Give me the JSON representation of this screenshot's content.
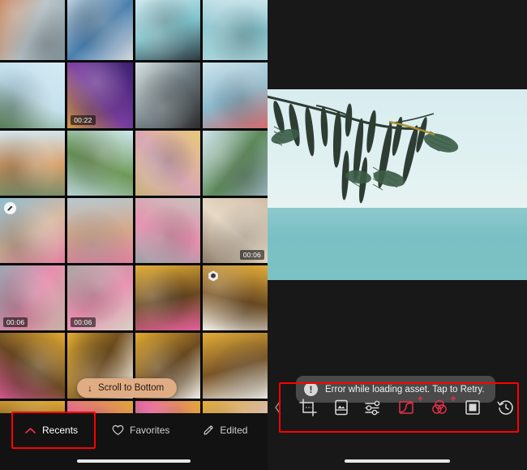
{
  "app": {
    "accent_red": "#e8304a",
    "annotation_color": "#ff0000",
    "panel_bg": "#121212"
  },
  "left_panel": {
    "scroll_pill": {
      "label": "Scroll to Bottom",
      "arrow_icon": "arrow-down-icon",
      "bg_color": "#e0ac84"
    },
    "tabs": [
      {
        "label": "Recents",
        "icon": "chevron-up-icon",
        "active": true,
        "annotated": true
      },
      {
        "label": "Favorites",
        "icon": "heart-icon",
        "active": false,
        "annotated": false
      },
      {
        "label": "Edited",
        "icon": "pencil-icon",
        "active": false,
        "annotated": false
      }
    ],
    "grid": {
      "columns": 4,
      "badges": {
        "video_durations": [
          "00:22",
          "00:06",
          "00:06",
          "00:06"
        ],
        "edit_badge_icon": "pencil-badge-icon",
        "burst_badge_icon": "burst-stack-icon"
      },
      "items": [
        {
          "id": 1,
          "kind": "photo",
          "desc": "woman in orange coat by waterfront",
          "c1": "#c4794a",
          "c2": "#b9c6cb",
          "c3": "#8fa3ab"
        },
        {
          "id": 2,
          "kind": "photo",
          "desc": "city skyline with cruise ship",
          "c1": "#cfe2ee",
          "c2": "#4a7fae",
          "c3": "#d6d9dc"
        },
        {
          "id": 3,
          "kind": "photo",
          "desc": "hanging clothes over sea",
          "c1": "#d9edf2",
          "c2": "#7fc3cc",
          "c3": "#2e3a40"
        },
        {
          "id": 4,
          "kind": "photo",
          "desc": "sea horizon pale blue",
          "c1": "#d5e9ef",
          "c2": "#86c3cd",
          "c3": "#a9d4da"
        },
        {
          "id": 5,
          "kind": "photo",
          "desc": "bright sky with tree and tower",
          "c1": "#d7ecf5",
          "c2": "#bcdcea",
          "c3": "#5f8a5c"
        },
        {
          "id": 6,
          "kind": "video",
          "duration": "00:22",
          "desc": "people with birthday cake at night",
          "c1": "#3a1f6e",
          "c2": "#7b3fa0",
          "c3": "#e0a44a"
        },
        {
          "id": 7,
          "kind": "photo",
          "desc": "man from behind on promenade",
          "c1": "#d9e4e4",
          "c2": "#6d7a80",
          "c3": "#2b2b2b"
        },
        {
          "id": 8,
          "kind": "photo",
          "desc": "bridge and river city view",
          "c1": "#cfe5ee",
          "c2": "#8bb8cc",
          "c3": "#d86a6a"
        },
        {
          "id": 9,
          "kind": "photo",
          "desc": "woman in hat at railing",
          "c1": "#d2e6ef",
          "c2": "#d8a06a",
          "c3": "#7a8f6a"
        },
        {
          "id": 10,
          "kind": "photo",
          "desc": "rooftop greenery and river",
          "c1": "#cfe8f0",
          "c2": "#6d9a57",
          "c3": "#b6cfd6"
        },
        {
          "id": 11,
          "kind": "photo",
          "desc": "ID cards on pink board",
          "c1": "#e8c97a",
          "c2": "#d9a7b4",
          "c3": "#c9b177"
        },
        {
          "id": 12,
          "kind": "photo",
          "desc": "riverside boats with trees",
          "c1": "#cfe4f0",
          "c2": "#5d8a5a",
          "c3": "#9fb8c3"
        },
        {
          "id": 13,
          "kind": "photo",
          "edited": true,
          "desc": "pool and cup hand",
          "c1": "#8fbcd0",
          "c2": "#d9b9a0",
          "c3": "#e07fa0"
        },
        {
          "id": 14,
          "kind": "photo",
          "desc": "harbor with drink in hand",
          "c1": "#b7c9cf",
          "c2": "#d5a98c",
          "c3": "#e07fa0"
        },
        {
          "id": 15,
          "kind": "photo",
          "desc": "hands holding pink cups",
          "c1": "#c8c4bd",
          "c2": "#e88fae",
          "c3": "#9aa0a6"
        },
        {
          "id": 16,
          "kind": "video",
          "duration": "00:06",
          "desc": "cups on table overhead",
          "c1": "#c9b39a",
          "c2": "#e7d9c6",
          "c3": "#8a7a68"
        },
        {
          "id": 17,
          "kind": "video",
          "duration": "00:06",
          "desc": "pink cup street scene",
          "c1": "#9aa5b0",
          "c2": "#e88fae",
          "c3": "#c2b2a4"
        },
        {
          "id": 18,
          "kind": "video",
          "duration": "00:06",
          "desc": "pink cups on pavement",
          "c1": "#a9a6a2",
          "c2": "#e88fae",
          "c3": "#d9d2c8"
        },
        {
          "id": 19,
          "kind": "photo",
          "desc": "yellow colonial building",
          "c1": "#e3ad33",
          "c2": "#6b4a22",
          "c3": "#e45f9b"
        },
        {
          "id": 20,
          "kind": "photo",
          "burst": true,
          "desc": "woman in white dress by yellow wall",
          "c1": "#e0aa36",
          "c2": "#7a5526",
          "c3": "#f2f0ea"
        },
        {
          "id": 21,
          "kind": "photo",
          "desc": "yellow wall with woman walking",
          "c1": "#dfa932",
          "c2": "#6b4a22",
          "c3": "#e45f9b"
        },
        {
          "id": 22,
          "kind": "photo",
          "desc": "woman in hat yellow facade",
          "c1": "#e1ab34",
          "c2": "#74501f",
          "c3": "#f4f2ec"
        },
        {
          "id": 23,
          "kind": "photo",
          "desc": "woman with bag yellow facade",
          "c1": "#dfa930",
          "c2": "#6e4c20",
          "c3": "#efeee8"
        },
        {
          "id": 24,
          "kind": "photo",
          "desc": "woman at yellow doorway",
          "c1": "#e2ac38",
          "c2": "#7a5526",
          "c3": "#f2f0ea"
        },
        {
          "id": 25,
          "kind": "photo",
          "desc": "yellow wall flowers lower",
          "c1": "#e0aa34",
          "c2": "#6b4a22",
          "c3": "#e45f9b"
        },
        {
          "id": 26,
          "kind": "photo",
          "desc": "flower boxes yellow wall",
          "c1": "#dfa932",
          "c2": "#e45f9b",
          "c3": "#7a5526"
        },
        {
          "id": 27,
          "kind": "photo",
          "desc": "pink flowers yellow wall",
          "c1": "#e1ab34",
          "c2": "#e45f9b",
          "c3": "#74501f"
        },
        {
          "id": 28,
          "kind": "photo",
          "desc": "portrait woman in hat",
          "c1": "#e3ad36",
          "c2": "#d9b89a",
          "c3": "#f2ece4"
        }
      ]
    }
  },
  "right_panel": {
    "preview": {
      "desc": "tree branch with long seed pods over teal sea",
      "sky_color": "#dff0f1",
      "sea_color": "#79c0c4"
    },
    "toast": {
      "icon": "exclamation-circle-icon",
      "icon_glyph": "!",
      "message": "Error while loading asset. Tap to Retry.",
      "bg_color": "#4a4a4a"
    },
    "toolbar": {
      "annotated": true,
      "back_icon": "chevron-left-icon",
      "tools": [
        {
          "name": "crop-tool",
          "icon": "crop-icon",
          "color": "#d9d9d9",
          "plus": false
        },
        {
          "name": "presets-tool",
          "icon": "image-presets-icon",
          "color": "#d9d9d9",
          "plus": false
        },
        {
          "name": "adjust-tool",
          "icon": "sliders-icon",
          "color": "#d9d9d9",
          "plus": false
        },
        {
          "name": "curves-tool",
          "icon": "tone-curve-icon",
          "color": "#e8304a",
          "plus": true,
          "plus_label": "+"
        },
        {
          "name": "color-mixer-tool",
          "icon": "color-mixer-icon",
          "color": "#e8304a",
          "plus": true,
          "plus_label": "+"
        },
        {
          "name": "vignette-tool",
          "icon": "frame-icon",
          "color": "#d9d9d9",
          "plus": false
        },
        {
          "name": "history-tool",
          "icon": "history-clock-icon",
          "color": "#d9d9d9",
          "plus": false
        }
      ]
    }
  }
}
